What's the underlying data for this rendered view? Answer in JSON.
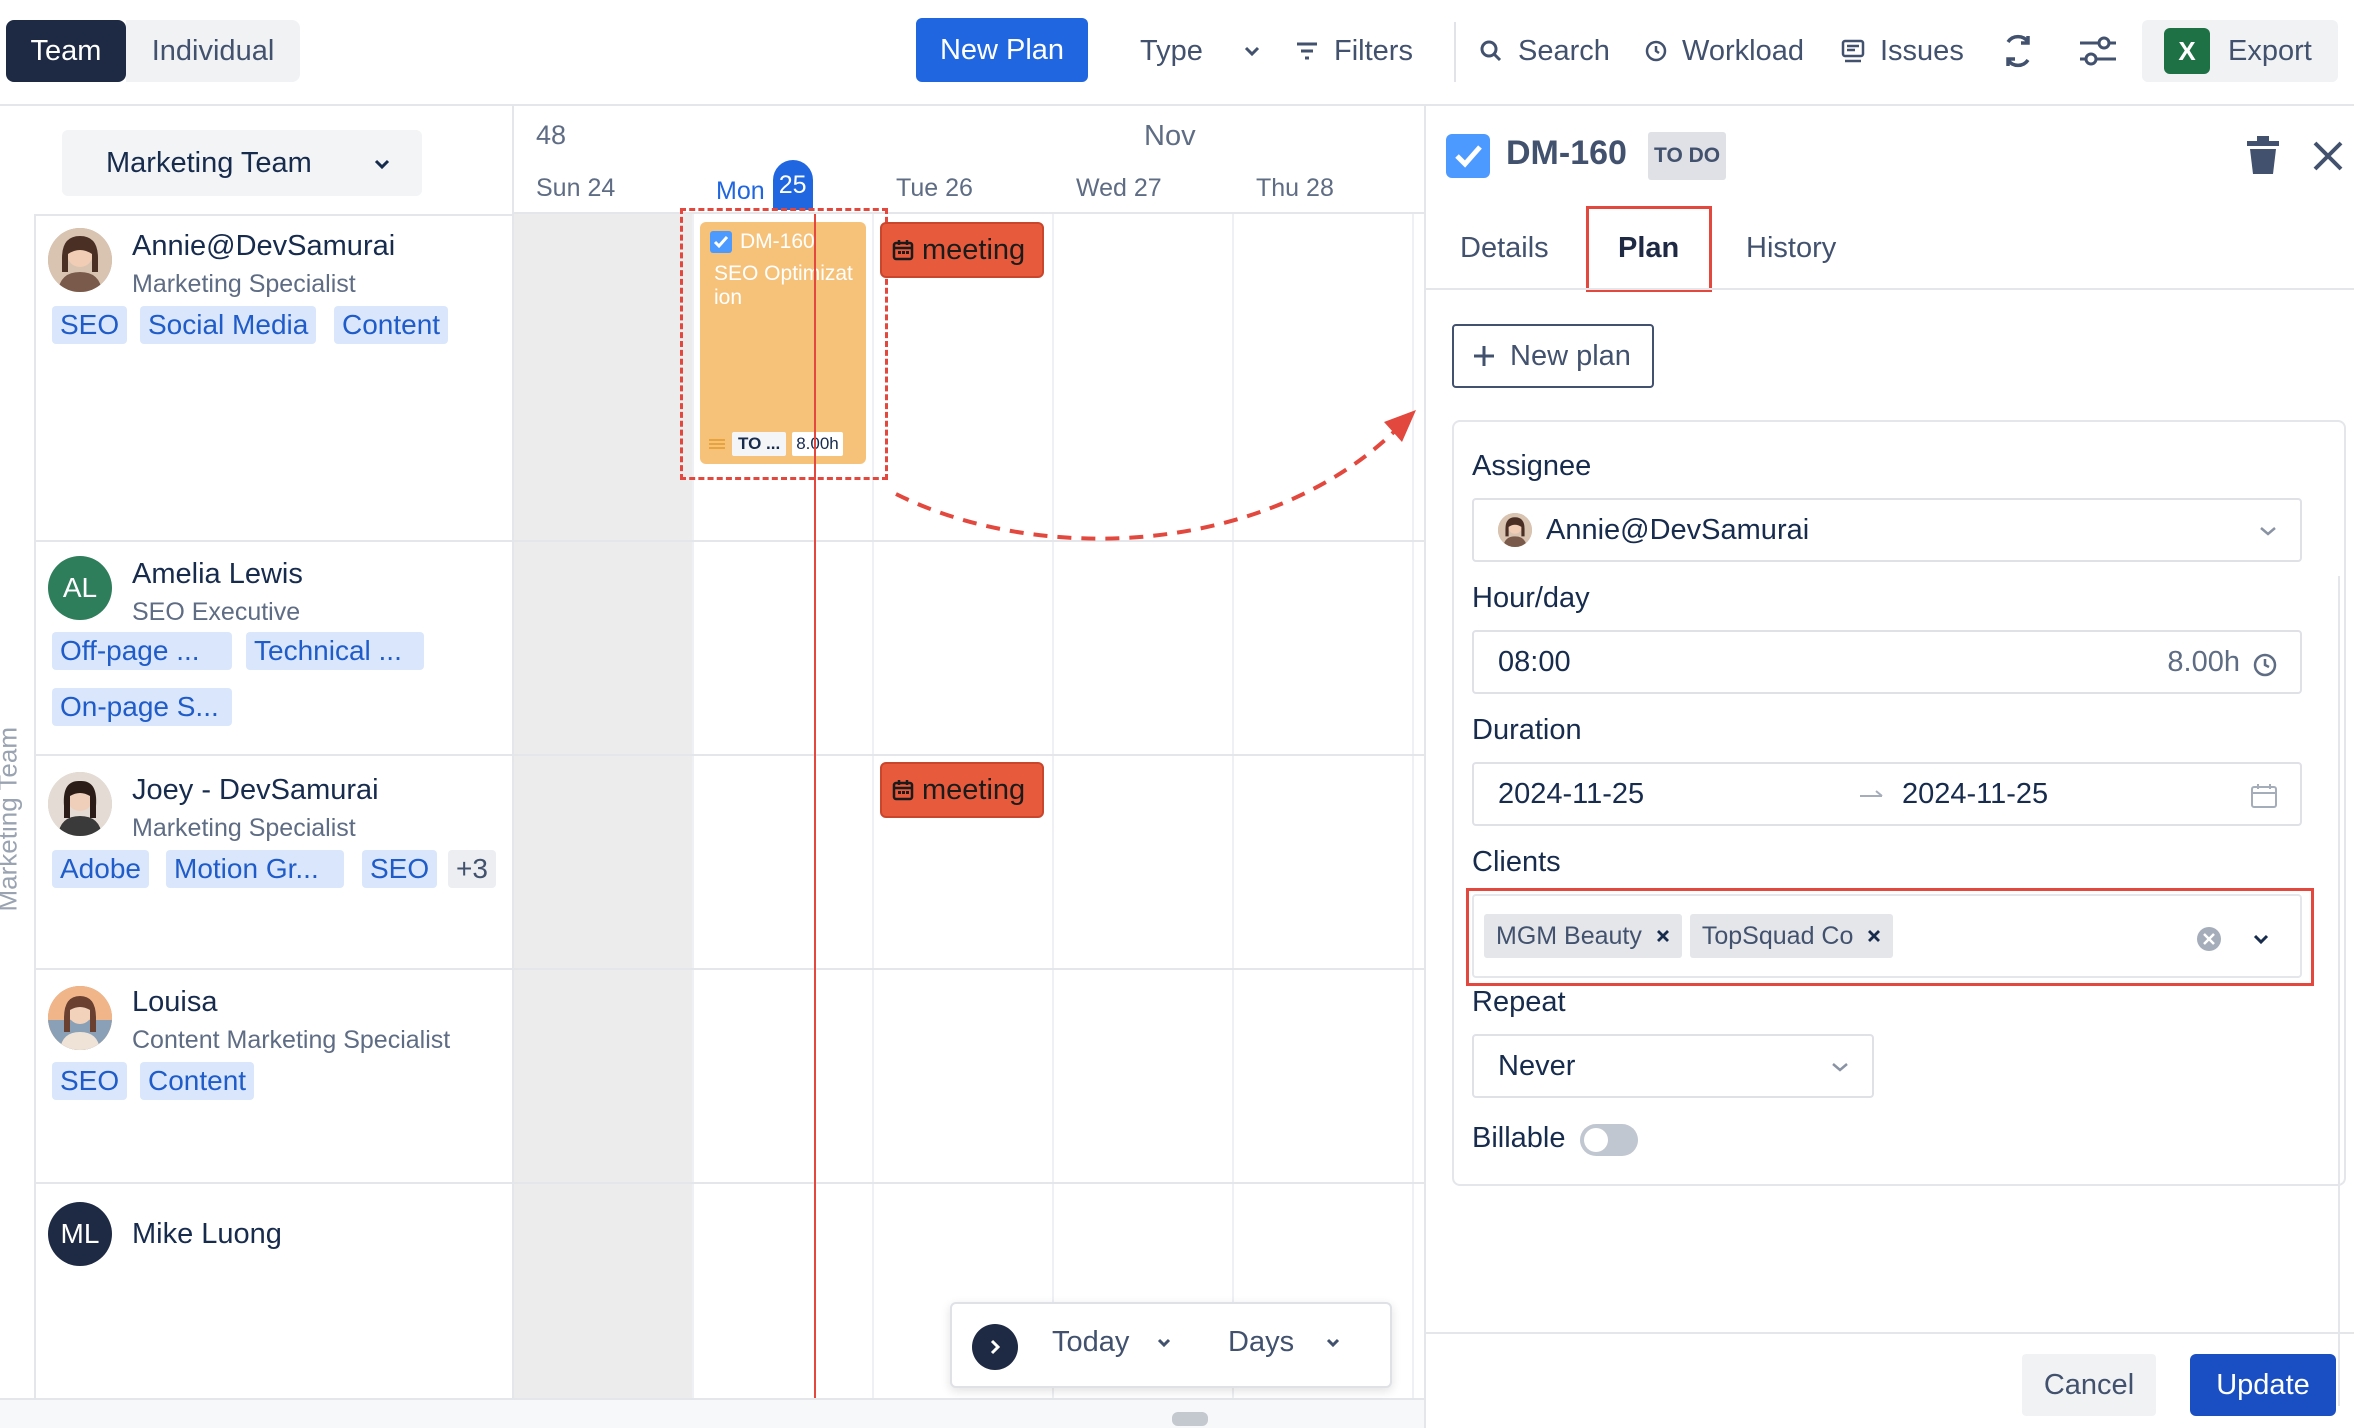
{
  "toolbar": {
    "view_modes": [
      {
        "label": "Team",
        "active": true
      },
      {
        "label": "Individual",
        "active": false
      }
    ],
    "new_plan_label": "New Plan",
    "type_label": "Type",
    "filters_label": "Filters",
    "search_label": "Search",
    "workload_label": "Workload",
    "issues_label": "Issues",
    "export_label": "Export",
    "export_icon_letter": "X"
  },
  "members_panel": {
    "team_selector": "Marketing Team",
    "vertical_label": "Marketing Team",
    "members": [
      {
        "name": "Annie@DevSamurai",
        "role": "Marketing Specialist",
        "tags": [
          "SEO",
          "Social Media",
          "Content"
        ],
        "avatar": "photo"
      },
      {
        "name": "Amelia Lewis",
        "role": "SEO Executive",
        "tags": [
          "Off-page ...",
          "Technical ...",
          "On-page S..."
        ],
        "avatar_initials": "AL",
        "avatar_color": "#2e7d5b"
      },
      {
        "name": "Joey - DevSamurai",
        "role": "Marketing Specialist",
        "tags": [
          "Adobe",
          "Motion Gr...",
          "SEO"
        ],
        "more": "+3",
        "avatar": "photo"
      },
      {
        "name": "Louisa",
        "role": "Content Marketing Specialist",
        "tags": [
          "SEO",
          "Content"
        ],
        "avatar": "photo"
      },
      {
        "name": "Mike Luong",
        "role": "",
        "tags": [],
        "avatar_initials": "ML",
        "avatar_color": "#1e2a44"
      }
    ]
  },
  "calendar": {
    "week_number": "48",
    "month": "Nov",
    "days": [
      {
        "name": "Sun",
        "num": "24",
        "today": false
      },
      {
        "name": "Mon",
        "num": "25",
        "today": true
      },
      {
        "name": "Tue",
        "num": "26",
        "today": false
      },
      {
        "name": "Wed",
        "num": "27",
        "today": false
      },
      {
        "name": "Thu",
        "num": "28",
        "today": false
      }
    ],
    "task": {
      "key": "DM-160",
      "title": "SEO Optimization",
      "status": "TO ...",
      "hours": "8.00h"
    },
    "meeting_label": "meeting"
  },
  "bottom_control": {
    "today_label": "Today",
    "days_label": "Days"
  },
  "panel": {
    "issue_key": "DM-160",
    "status": "TO DO",
    "tabs": [
      "Details",
      "Plan",
      "History"
    ],
    "active_tab": "Plan",
    "new_plan_label": "New plan",
    "assignee_label": "Assignee",
    "assignee_value": "Annie@DevSamurai",
    "hourday_label": "Hour/day",
    "hourday_value": "08:00",
    "hourday_total": "8.00h",
    "duration_label": "Duration",
    "duration_start": "2024-11-25",
    "duration_end": "2024-11-25",
    "clients_label": "Clients",
    "clients": [
      "MGM Beauty",
      "TopSquad Co"
    ],
    "repeat_label": "Repeat",
    "repeat_value": "Never",
    "billable_label": "Billable",
    "billable": false,
    "cancel_label": "Cancel",
    "update_label": "Update"
  },
  "colors": {
    "primary": "#1f66e0",
    "dark": "#1e2a44",
    "tag_bg": "#d9e6fb",
    "tag_text": "#1f5cc9",
    "task_bg": "#f6c27a",
    "meeting_bg": "#e85a3c",
    "highlight_red": "#e2483d"
  }
}
